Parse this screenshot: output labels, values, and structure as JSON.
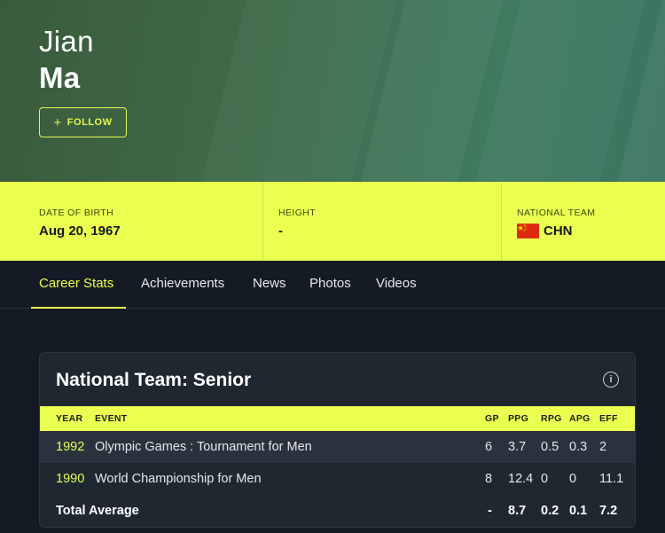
{
  "player": {
    "first_name": "Jian",
    "last_name": "Ma",
    "follow_label": "FOLLOW"
  },
  "info": {
    "dob_label": "DATE OF BIRTH",
    "dob_value": "Aug 20, 1967",
    "height_label": "HEIGHT",
    "height_value": "-",
    "team_label": "NATIONAL TEAM",
    "team_value": "CHN",
    "team_flag_icon": "china-flag-icon"
  },
  "tabs": [
    {
      "label": "Career Stats",
      "active": true
    },
    {
      "label": "Achievements"
    },
    {
      "label": "News"
    },
    {
      "label": "Photos"
    },
    {
      "label": "Videos"
    }
  ],
  "stats": {
    "title": "National Team: Senior",
    "headers": {
      "year": "YEAR",
      "event": "EVENT",
      "gp": "GP",
      "ppg": "PPG",
      "rpg": "RPG",
      "apg": "APG",
      "eff": "EFF"
    },
    "rows": [
      {
        "year": "1992",
        "event": "Olympic Games : Tournament for Men",
        "gp": "6",
        "ppg": "3.7",
        "rpg": "0.5",
        "apg": "0.3",
        "eff": "2"
      },
      {
        "year": "1990",
        "event": "World Championship for Men",
        "gp": "8",
        "ppg": "12.4",
        "rpg": "0",
        "apg": "0",
        "eff": "11.1"
      }
    ],
    "total": {
      "label": "Total Average",
      "gp": "-",
      "ppg": "8.7",
      "rpg": "0.2",
      "apg": "0.1",
      "eff": "7.2"
    }
  },
  "colors": {
    "accent": "#eaff4f",
    "background": "#151b24",
    "card": "#1f2731"
  }
}
